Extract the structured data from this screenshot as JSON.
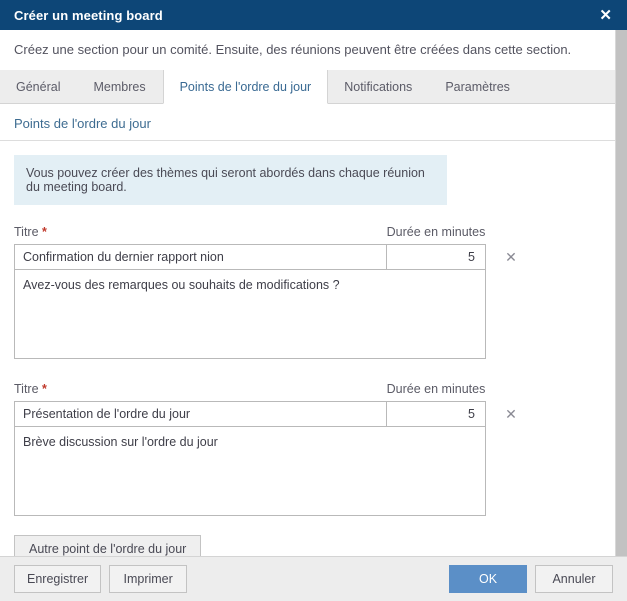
{
  "window": {
    "title": "Créer un meeting board",
    "close_icon": "close-icon",
    "close_glyph": "✕"
  },
  "description": "Créez une section pour un comité. Ensuite, des réunions peuvent être créées dans cette section.",
  "tabs": [
    {
      "label": "Général",
      "active": false
    },
    {
      "label": "Membres",
      "active": false
    },
    {
      "label": "Points de l'ordre du jour",
      "active": true
    },
    {
      "label": "Notifications",
      "active": false
    },
    {
      "label": "Paramètres",
      "active": false
    }
  ],
  "section": {
    "title": "Points de l'ordre du jour",
    "info_banner": "Vous pouvez créer des thèmes qui seront abordés dans chaque réunion du meeting board."
  },
  "labels": {
    "title_label": "Titre",
    "required_marker": "*",
    "duration_label": "Durée en minutes",
    "remove_icon": "close-icon",
    "remove_glyph": "✕"
  },
  "agenda_items": [
    {
      "title": "Confirmation du dernier rapport nion",
      "duration": "5",
      "description": "Avez-vous des remarques ou souhaits de modifications ?"
    },
    {
      "title": "Présentation de l'ordre du jour",
      "duration": "5",
      "description": "Brève discussion sur l'ordre du jour"
    }
  ],
  "add_button": "Autre point de l'ordre du jour",
  "footer": {
    "save": "Enregistrer",
    "print": "Imprimer",
    "ok": "OK",
    "cancel": "Annuler"
  },
  "colors": {
    "titlebar": "#0d4677",
    "primary_button": "#5b8fc7",
    "info_banner": "#e3eff5",
    "tab_strip": "#ededed",
    "required": "#c0392b"
  }
}
